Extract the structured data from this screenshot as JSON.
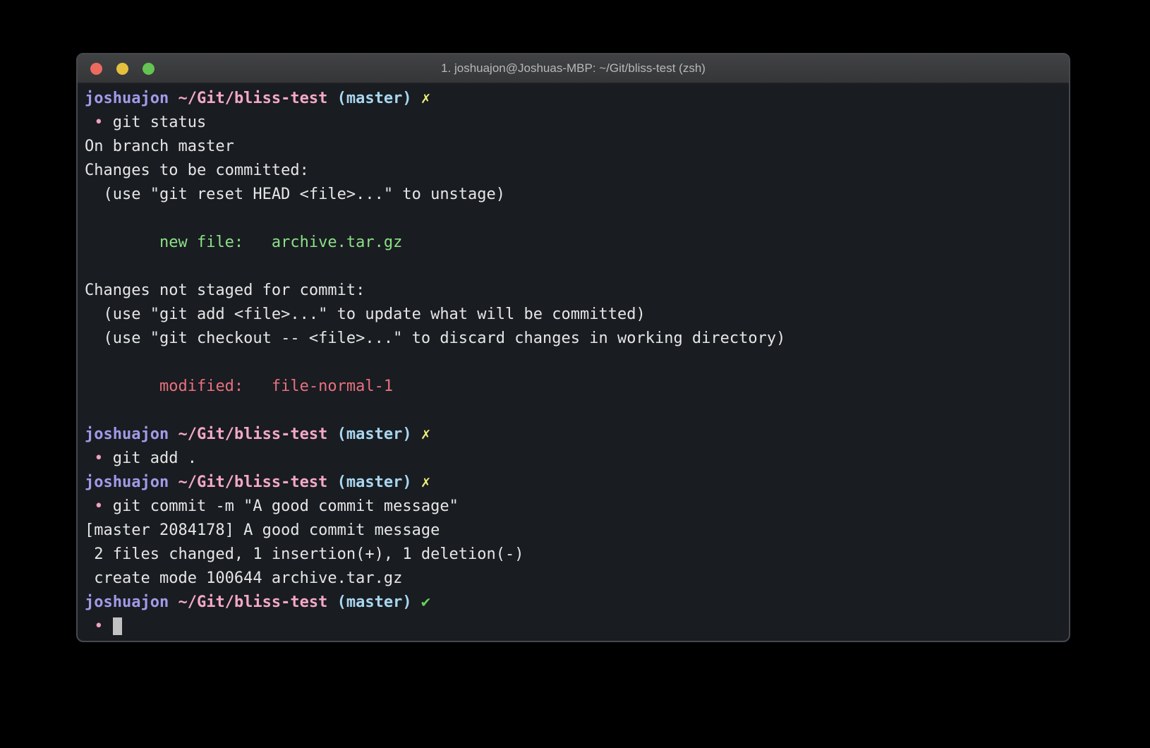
{
  "window": {
    "title": "1. joshuajon@Joshuas-MBP: ~/Git/bliss-test (zsh)",
    "traffic_lights": [
      {
        "name": "close",
        "color": "#ed6a5f"
      },
      {
        "name": "minimize",
        "color": "#e5c03e"
      },
      {
        "name": "zoom",
        "color": "#64c352"
      }
    ]
  },
  "colors": {
    "page_bg": "#000000",
    "window_border": "#45494e",
    "terminal_bg": "#191c21",
    "titlebar_top": "#414244",
    "titlebar_bottom": "#353638",
    "title_text": "#b6b8ba",
    "fg": "#e6e6e6",
    "user": "#a29ae8",
    "path": "#f5a8c8",
    "branch": "#a8d7f0",
    "fail": "#f2ec79",
    "ok": "#67d05b",
    "bullet": "#f2a0c4",
    "added": "#8ce087",
    "modified": "#e8717f",
    "cursor": "#c2c2c2"
  },
  "terminal": {
    "prompt": {
      "user": "joshuajon",
      "path": "~/Git/bliss-test",
      "branch": "(master)",
      "fail_mark": "✗",
      "ok_mark": "✔"
    },
    "lines": [
      {
        "name": "prompt-line",
        "segments": [
          {
            "t": "joshuajon",
            "c": "user",
            "b": true
          },
          {
            "t": " ",
            "c": "fg"
          },
          {
            "t": "~/Git/bliss-test",
            "c": "path",
            "b": true
          },
          {
            "t": " ",
            "c": "fg"
          },
          {
            "t": "(master)",
            "c": "branch",
            "b": true
          },
          {
            "t": " ",
            "c": "fg"
          },
          {
            "t": "✗",
            "c": "fail",
            "b": true
          }
        ]
      },
      {
        "name": "command-line",
        "segments": [
          {
            "t": " ",
            "c": "fg"
          },
          {
            "t": "•",
            "c": "bullet"
          },
          {
            "t": " git status",
            "c": "fg"
          }
        ]
      },
      {
        "name": "output-line",
        "segments": [
          {
            "t": "On branch master",
            "c": "fg"
          }
        ]
      },
      {
        "name": "output-line",
        "segments": [
          {
            "t": "Changes to be committed:",
            "c": "fg"
          }
        ]
      },
      {
        "name": "output-line",
        "segments": [
          {
            "t": "  (use \"git reset HEAD <file>...\" to unstage)",
            "c": "fg"
          }
        ]
      },
      {
        "name": "blank-line",
        "segments": []
      },
      {
        "name": "output-line",
        "segments": [
          {
            "t": "        ",
            "c": "fg"
          },
          {
            "t": "new file:   archive.tar.gz",
            "c": "added"
          }
        ]
      },
      {
        "name": "blank-line",
        "segments": []
      },
      {
        "name": "output-line",
        "segments": [
          {
            "t": "Changes not staged for commit:",
            "c": "fg"
          }
        ]
      },
      {
        "name": "output-line",
        "segments": [
          {
            "t": "  (use \"git add <file>...\" to update what will be committed)",
            "c": "fg"
          }
        ]
      },
      {
        "name": "output-line",
        "segments": [
          {
            "t": "  (use \"git checkout -- <file>...\" to discard changes in working directory)",
            "c": "fg"
          }
        ]
      },
      {
        "name": "blank-line",
        "segments": []
      },
      {
        "name": "output-line",
        "segments": [
          {
            "t": "        ",
            "c": "fg"
          },
          {
            "t": "modified:   file-normal-1",
            "c": "modified"
          }
        ]
      },
      {
        "name": "blank-line",
        "segments": []
      },
      {
        "name": "prompt-line",
        "segments": [
          {
            "t": "joshuajon",
            "c": "user",
            "b": true
          },
          {
            "t": " ",
            "c": "fg"
          },
          {
            "t": "~/Git/bliss-test",
            "c": "path",
            "b": true
          },
          {
            "t": " ",
            "c": "fg"
          },
          {
            "t": "(master)",
            "c": "branch",
            "b": true
          },
          {
            "t": " ",
            "c": "fg"
          },
          {
            "t": "✗",
            "c": "fail",
            "b": true
          }
        ]
      },
      {
        "name": "command-line",
        "segments": [
          {
            "t": " ",
            "c": "fg"
          },
          {
            "t": "•",
            "c": "bullet"
          },
          {
            "t": " git add .",
            "c": "fg"
          }
        ]
      },
      {
        "name": "prompt-line",
        "segments": [
          {
            "t": "joshuajon",
            "c": "user",
            "b": true
          },
          {
            "t": " ",
            "c": "fg"
          },
          {
            "t": "~/Git/bliss-test",
            "c": "path",
            "b": true
          },
          {
            "t": " ",
            "c": "fg"
          },
          {
            "t": "(master)",
            "c": "branch",
            "b": true
          },
          {
            "t": " ",
            "c": "fg"
          },
          {
            "t": "✗",
            "c": "fail",
            "b": true
          }
        ]
      },
      {
        "name": "command-line",
        "segments": [
          {
            "t": " ",
            "c": "fg"
          },
          {
            "t": "•",
            "c": "bullet"
          },
          {
            "t": " git commit -m \"A good commit message\"",
            "c": "fg"
          }
        ]
      },
      {
        "name": "output-line",
        "segments": [
          {
            "t": "[master 2084178] A good commit message",
            "c": "fg"
          }
        ]
      },
      {
        "name": "output-line",
        "segments": [
          {
            "t": " 2 files changed, 1 insertion(+), 1 deletion(-)",
            "c": "fg"
          }
        ]
      },
      {
        "name": "output-line",
        "segments": [
          {
            "t": " create mode 100644 archive.tar.gz",
            "c": "fg"
          }
        ]
      },
      {
        "name": "prompt-line",
        "segments": [
          {
            "t": "joshuajon",
            "c": "user",
            "b": true
          },
          {
            "t": " ",
            "c": "fg"
          },
          {
            "t": "~/Git/bliss-test",
            "c": "path",
            "b": true
          },
          {
            "t": " ",
            "c": "fg"
          },
          {
            "t": "(master)",
            "c": "branch",
            "b": true
          },
          {
            "t": " ",
            "c": "fg"
          },
          {
            "t": "✔",
            "c": "ok",
            "b": true
          }
        ]
      },
      {
        "name": "cursor-line",
        "segments": [
          {
            "t": " ",
            "c": "fg"
          },
          {
            "t": "•",
            "c": "bullet"
          },
          {
            "t": " ",
            "c": "fg"
          },
          {
            "t": " ",
            "c": "cursor"
          }
        ]
      }
    ]
  }
}
